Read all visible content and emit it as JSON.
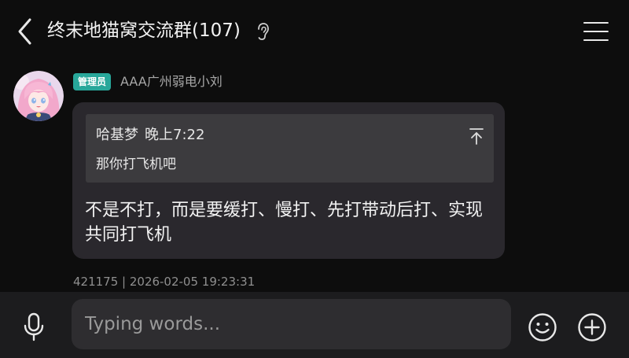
{
  "header": {
    "title": "终末地猫窝交流群(107)",
    "back_icon": "chevron-left-icon",
    "ear_icon": "ear-icon",
    "menu_icon": "menu-icon"
  },
  "message": {
    "avatar": "anime-girl-avatar",
    "admin_badge": "管理员",
    "sender": "AAA广州弱电小刘",
    "quote": {
      "author": "哈基梦",
      "time": "晚上7:22",
      "text": "那你打飞机吧",
      "jump_icon": "jump-to-top-icon"
    },
    "text": "不是不打，而是要缓打、慢打、先打带动后打、实现共同打飞机",
    "meta": "421175 | 2026-02-05 19:23:31"
  },
  "composer": {
    "placeholder": "Typing words...",
    "voice_icon": "microphone-icon",
    "emoji_icon": "emoji-smile-icon",
    "add_icon": "plus-circle-icon"
  },
  "colors": {
    "background": "#0d0d0d",
    "bubble": "#2a282d",
    "quote": "#3c3b3e",
    "admin_badge": "#28a79a",
    "bottom_bar": "#1c1c1e"
  }
}
